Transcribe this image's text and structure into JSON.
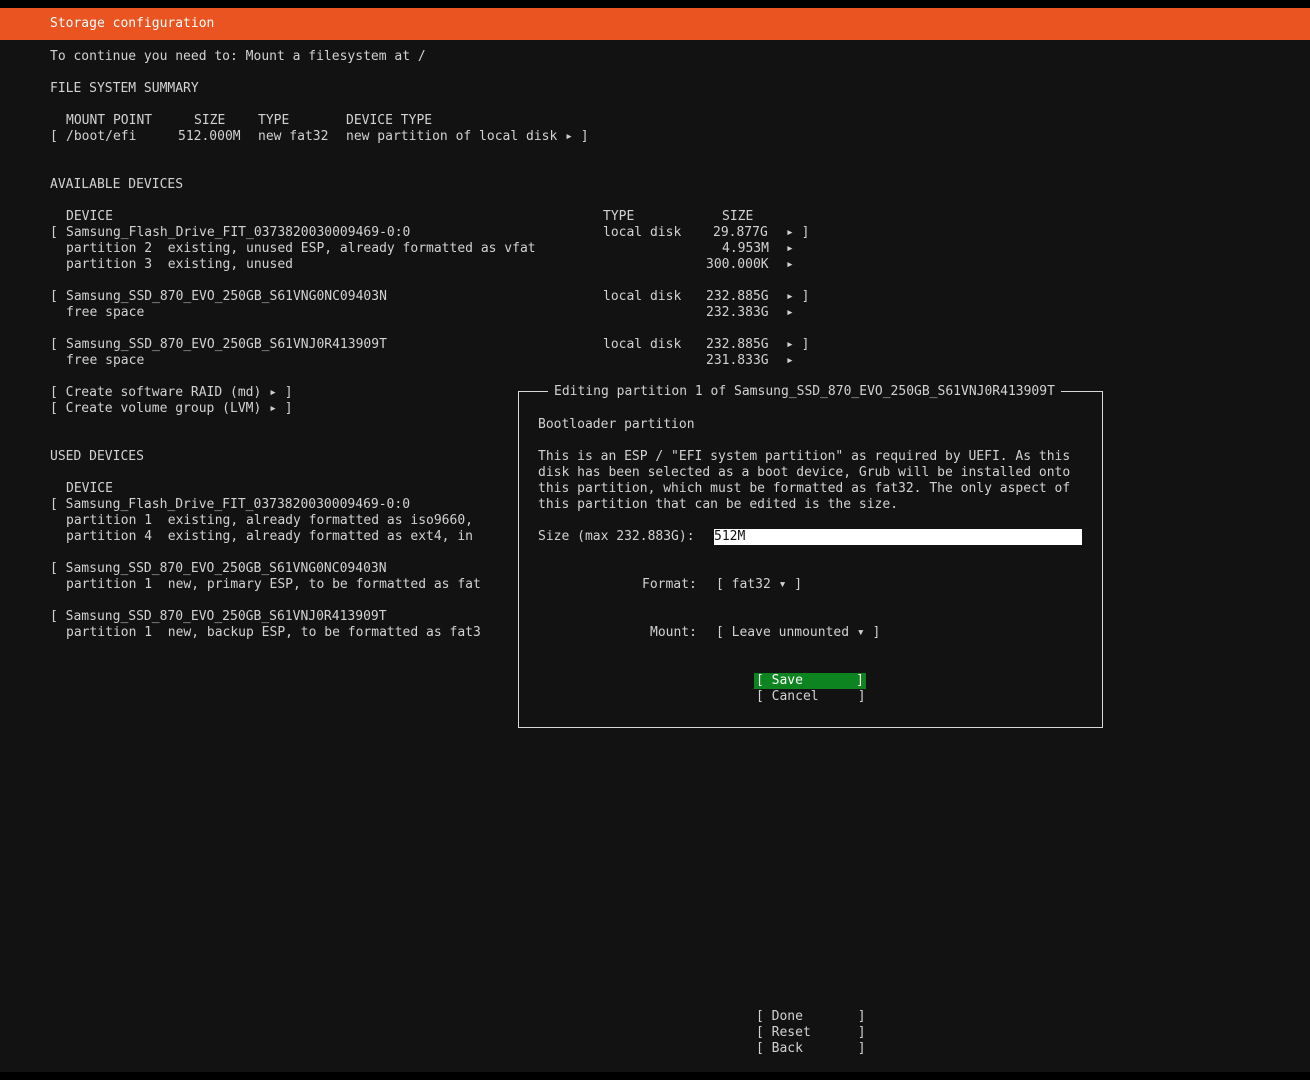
{
  "header": {
    "title": "Storage configuration"
  },
  "notice": "To continue you need to: Mount a filesystem at /",
  "fs_summary": {
    "heading": "FILE SYSTEM SUMMARY",
    "columns": {
      "mount": "MOUNT POINT",
      "size": "SIZE",
      "type": "TYPE",
      "device_type": "DEVICE TYPE"
    },
    "row": {
      "open": "[",
      "mount": "/boot/efi",
      "size": "512.000M",
      "type": "new fat32",
      "device_type": "new partition of local disk ▸ ]"
    }
  },
  "available": {
    "heading": "AVAILABLE DEVICES",
    "columns": {
      "device": "DEVICE",
      "type": "TYPE",
      "size": "SIZE"
    },
    "disk1": {
      "open": "[",
      "name": "Samsung_Flash_Drive_FIT_0373820030009469-0:0",
      "type": "local disk",
      "size": "29.877G",
      "arrow": "▸ ]",
      "p2": {
        "label": "partition 2  existing, unused ESP, already formatted as vfat",
        "size": "4.953M",
        "arrow": "▸"
      },
      "p3": {
        "label": "partition 3  existing, unused",
        "size": "300.000K",
        "arrow": "▸"
      }
    },
    "disk2": {
      "open": "[",
      "name": "Samsung_SSD_870_EVO_250GB_S61VNG0NC09403N",
      "type": "local disk",
      "size": "232.885G",
      "arrow": "▸ ]",
      "free": {
        "label": "free space",
        "size": "232.383G",
        "arrow": "▸"
      }
    },
    "disk3": {
      "open": "[",
      "name": "Samsung_SSD_870_EVO_250GB_S61VNJ0R413909T",
      "type": "local disk",
      "size": "232.885G",
      "arrow": "▸ ]",
      "free": {
        "label": "free space",
        "size": "231.833G",
        "arrow": "▸"
      }
    },
    "raid": "[ Create software RAID (md) ▸ ]",
    "lvm": "[ Create volume group (LVM) ▸ ]"
  },
  "used": {
    "heading": "USED DEVICES",
    "column_device": "DEVICE",
    "u1": {
      "name": "[ Samsung_Flash_Drive_FIT_0373820030009469-0:0",
      "p1": "partition 1  existing, already formatted as iso9660,",
      "p4": "partition 4  existing, already formatted as ext4, in"
    },
    "u2": {
      "name": "[ Samsung_SSD_870_EVO_250GB_S61VNG0NC09403N",
      "p1": "partition 1  new, primary ESP, to be formatted as fat"
    },
    "u3": {
      "name": "[ Samsung_SSD_870_EVO_250GB_S61VNJ0R413909T",
      "p1": "partition 1  new, backup ESP, to be formatted as fat3"
    }
  },
  "dialog": {
    "title": "Editing partition 1 of Samsung_SSD_870_EVO_250GB_S61VNJ0R413909T",
    "subtitle": "Bootloader partition",
    "desc": [
      "This is an ESP / \"EFI system partition\" as required by UEFI. As this",
      "disk has been selected as a boot device, Grub will be installed onto",
      "this partition, which must be formatted as fat32. The only aspect of",
      "this partition that can be edited is the size."
    ],
    "size_label": "Size (max 232.883G):",
    "size_value": "512M",
    "format_label": "Format:",
    "format_value": "[ fat32 ▾ ]",
    "mount_label": "Mount:",
    "mount_value": "[ Leave unmounted ▾ ]",
    "save_label": "[ Save",
    "cancel_label": "[ Cancel     ]",
    "bracket_close": "]"
  },
  "footer": {
    "done": "[ Done       ]",
    "reset": "[ Reset      ]",
    "back": "[ Back       ]"
  },
  "colors": {
    "accent": "#e95420",
    "selected": "#0e8420",
    "background": "#121212"
  }
}
